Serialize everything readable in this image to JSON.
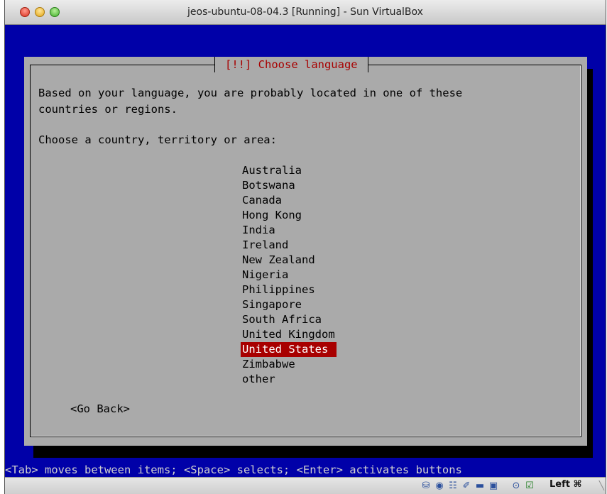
{
  "window": {
    "title": "jeos-ubuntu-08-04.3 [Running] - Sun VirtualBox"
  },
  "dialog": {
    "title": "[!!] Choose language",
    "description_line1": "Based on your language, you are probably located in one of these",
    "description_line2": "countries or regions.",
    "prompt": "Choose a country, territory or area:",
    "countries": [
      "Australia",
      "Botswana",
      "Canada",
      "Hong Kong",
      "India",
      "Ireland",
      "New Zealand",
      "Nigeria",
      "Philippines",
      "Singapore",
      "South Africa",
      "United Kingdom",
      "United States",
      "Zimbabwe",
      "other"
    ],
    "selected": "United States",
    "go_back": "<Go Back>"
  },
  "hint": "<Tab> moves between items; <Space> selects; <Enter> activates buttons",
  "statusbar": {
    "icons": [
      "hard-disk-icon",
      "cd-icon",
      "network-icon",
      "usb-icon",
      "shared-folder-icon",
      "vrdp-icon",
      "mouse-integration-icon",
      "hostkey-icon"
    ],
    "host_key_label": "Left ⌘"
  },
  "colors": {
    "vm_background": "#0000a8",
    "dialog": "#aaaaaa",
    "title_text": "#a80000",
    "selection": "#a80000"
  }
}
